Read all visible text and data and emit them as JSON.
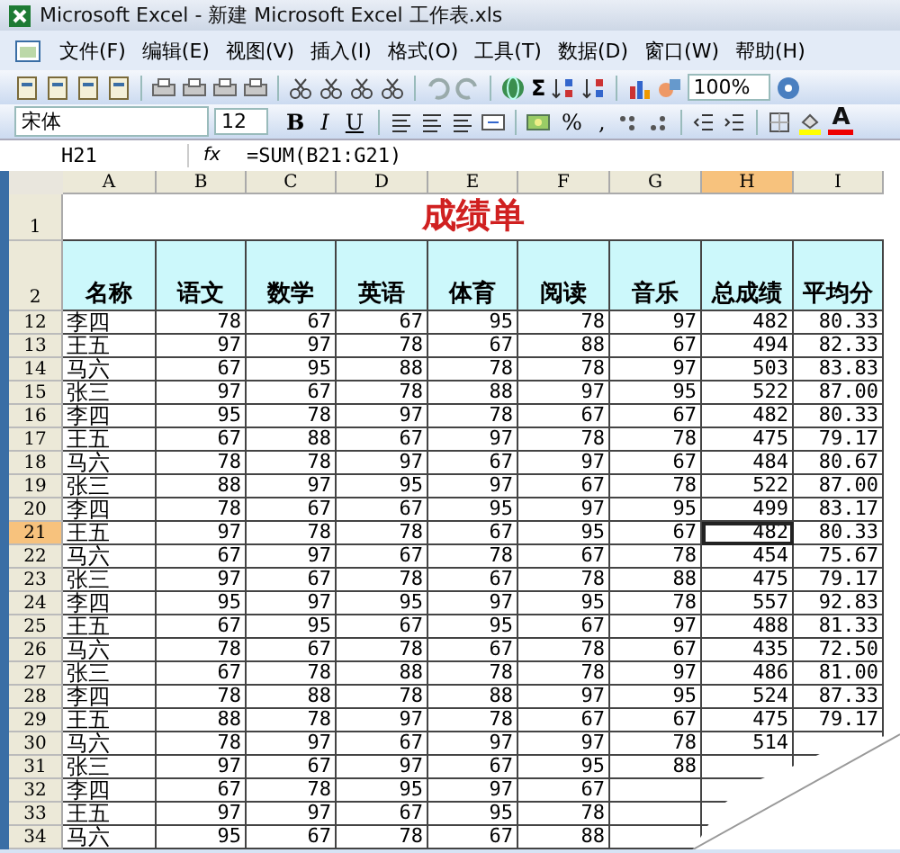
{
  "window": {
    "title": "Microsoft Excel - 新建 Microsoft Excel 工作表.xls"
  },
  "menu": [
    "文件(F)",
    "编辑(E)",
    "视图(V)",
    "插入(I)",
    "格式(O)",
    "工具(T)",
    "数据(D)",
    "窗口(W)",
    "帮助(H)"
  ],
  "toolbar": {
    "sum_symbol": "Σ",
    "zoom": "100%"
  },
  "format_bar": {
    "font": "宋体",
    "size": "12",
    "bold": "B",
    "italic": "I",
    "underline": "U",
    "percent": "%",
    "comma": ",",
    "font_color": "A"
  },
  "formula_bar": {
    "name_box": "H21",
    "fx": "fx",
    "formula": "=SUM(B21:G21)"
  },
  "columns": [
    {
      "label": "A",
      "selected": false
    },
    {
      "label": "B",
      "selected": false
    },
    {
      "label": "C",
      "selected": false
    },
    {
      "label": "D",
      "selected": false
    },
    {
      "label": "E",
      "selected": false
    },
    {
      "label": "F",
      "selected": false
    },
    {
      "label": "G",
      "selected": false
    },
    {
      "label": "H",
      "selected": true
    },
    {
      "label": "I",
      "selected": false
    }
  ],
  "title_row": {
    "num": "1",
    "text": "成绩单"
  },
  "header_row": {
    "num": "2",
    "cells": [
      "名称",
      "语文",
      "数学",
      "英语",
      "体育",
      "阅读",
      "音乐",
      "总成绩",
      "平均分"
    ]
  },
  "rows": [
    {
      "num": "12",
      "selected": false,
      "cells": [
        "李四",
        "78",
        "67",
        "67",
        "95",
        "78",
        "97",
        "482",
        "80.33"
      ]
    },
    {
      "num": "13",
      "selected": false,
      "cells": [
        "王五",
        "97",
        "97",
        "78",
        "67",
        "88",
        "67",
        "494",
        "82.33"
      ]
    },
    {
      "num": "14",
      "selected": false,
      "cells": [
        "马六",
        "67",
        "95",
        "88",
        "78",
        "78",
        "97",
        "503",
        "83.83"
      ]
    },
    {
      "num": "15",
      "selected": false,
      "cells": [
        "张三",
        "97",
        "67",
        "78",
        "88",
        "97",
        "95",
        "522",
        "87.00"
      ]
    },
    {
      "num": "16",
      "selected": false,
      "cells": [
        "李四",
        "95",
        "78",
        "97",
        "78",
        "67",
        "67",
        "482",
        "80.33"
      ]
    },
    {
      "num": "17",
      "selected": false,
      "cells": [
        "王五",
        "67",
        "88",
        "67",
        "97",
        "78",
        "78",
        "475",
        "79.17"
      ]
    },
    {
      "num": "18",
      "selected": false,
      "cells": [
        "马六",
        "78",
        "78",
        "97",
        "67",
        "97",
        "67",
        "484",
        "80.67"
      ]
    },
    {
      "num": "19",
      "selected": false,
      "cells": [
        "张三",
        "88",
        "97",
        "95",
        "97",
        "67",
        "78",
        "522",
        "87.00"
      ]
    },
    {
      "num": "20",
      "selected": false,
      "cells": [
        "李四",
        "78",
        "67",
        "67",
        "95",
        "97",
        "95",
        "499",
        "83.17"
      ]
    },
    {
      "num": "21",
      "selected": true,
      "cells": [
        "王五",
        "97",
        "78",
        "78",
        "67",
        "95",
        "67",
        "482",
        "80.33"
      ]
    },
    {
      "num": "22",
      "selected": false,
      "cells": [
        "马六",
        "67",
        "97",
        "67",
        "78",
        "67",
        "78",
        "454",
        "75.67"
      ]
    },
    {
      "num": "23",
      "selected": false,
      "cells": [
        "张三",
        "97",
        "67",
        "78",
        "67",
        "78",
        "88",
        "475",
        "79.17"
      ]
    },
    {
      "num": "24",
      "selected": false,
      "cells": [
        "李四",
        "95",
        "97",
        "95",
        "97",
        "95",
        "78",
        "557",
        "92.83"
      ]
    },
    {
      "num": "25",
      "selected": false,
      "cells": [
        "王五",
        "67",
        "95",
        "67",
        "95",
        "67",
        "97",
        "488",
        "81.33"
      ]
    },
    {
      "num": "26",
      "selected": false,
      "cells": [
        "马六",
        "78",
        "67",
        "78",
        "67",
        "78",
        "67",
        "435",
        "72.50"
      ]
    },
    {
      "num": "27",
      "selected": false,
      "cells": [
        "张三",
        "67",
        "78",
        "88",
        "78",
        "78",
        "97",
        "486",
        "81.00"
      ]
    },
    {
      "num": "28",
      "selected": false,
      "cells": [
        "李四",
        "78",
        "88",
        "78",
        "88",
        "97",
        "95",
        "524",
        "87.33"
      ]
    },
    {
      "num": "29",
      "selected": false,
      "cells": [
        "王五",
        "88",
        "78",
        "97",
        "78",
        "67",
        "67",
        "475",
        "79.17"
      ]
    },
    {
      "num": "30",
      "selected": false,
      "cells": [
        "马六",
        "78",
        "97",
        "67",
        "97",
        "97",
        "78",
        "514"
      ]
    },
    {
      "num": "31",
      "selected": false,
      "cells": [
        "张三",
        "97",
        "67",
        "97",
        "67",
        "95",
        "88"
      ]
    },
    {
      "num": "32",
      "selected": false,
      "cells": [
        "李四",
        "67",
        "78",
        "95",
        "97",
        "67"
      ]
    },
    {
      "num": "33",
      "selected": false,
      "cells": [
        "王五",
        "97",
        "97",
        "67",
        "95",
        "78"
      ]
    },
    {
      "num": "34",
      "selected": false,
      "cells": [
        "马六",
        "95",
        "67",
        "78",
        "67",
        "88"
      ]
    }
  ]
}
